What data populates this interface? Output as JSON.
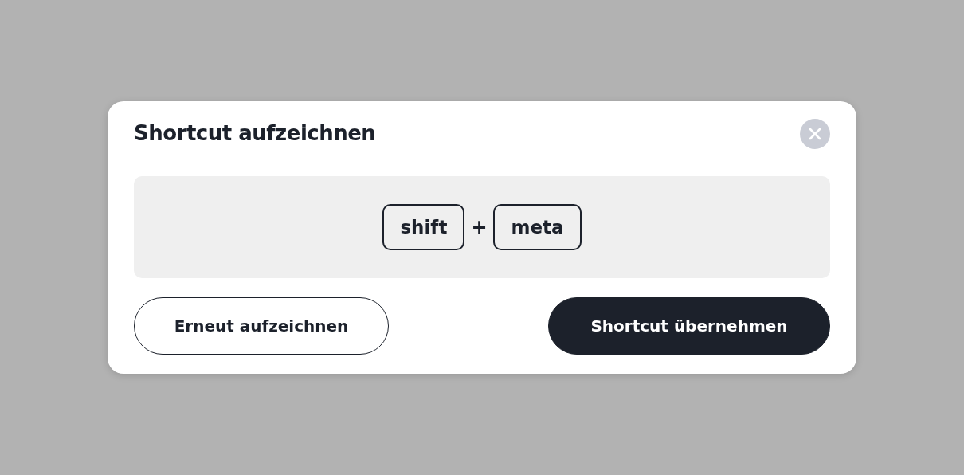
{
  "dialog": {
    "title": "Shortcut aufzeichnen",
    "keys": [
      "shift",
      "meta"
    ],
    "separator": "+",
    "buttons": [
      {
        "label": "Erneut aufzeichnen",
        "kind": "secondary"
      },
      {
        "label": "Shortcut übernehmen",
        "kind": "primary"
      }
    ]
  }
}
